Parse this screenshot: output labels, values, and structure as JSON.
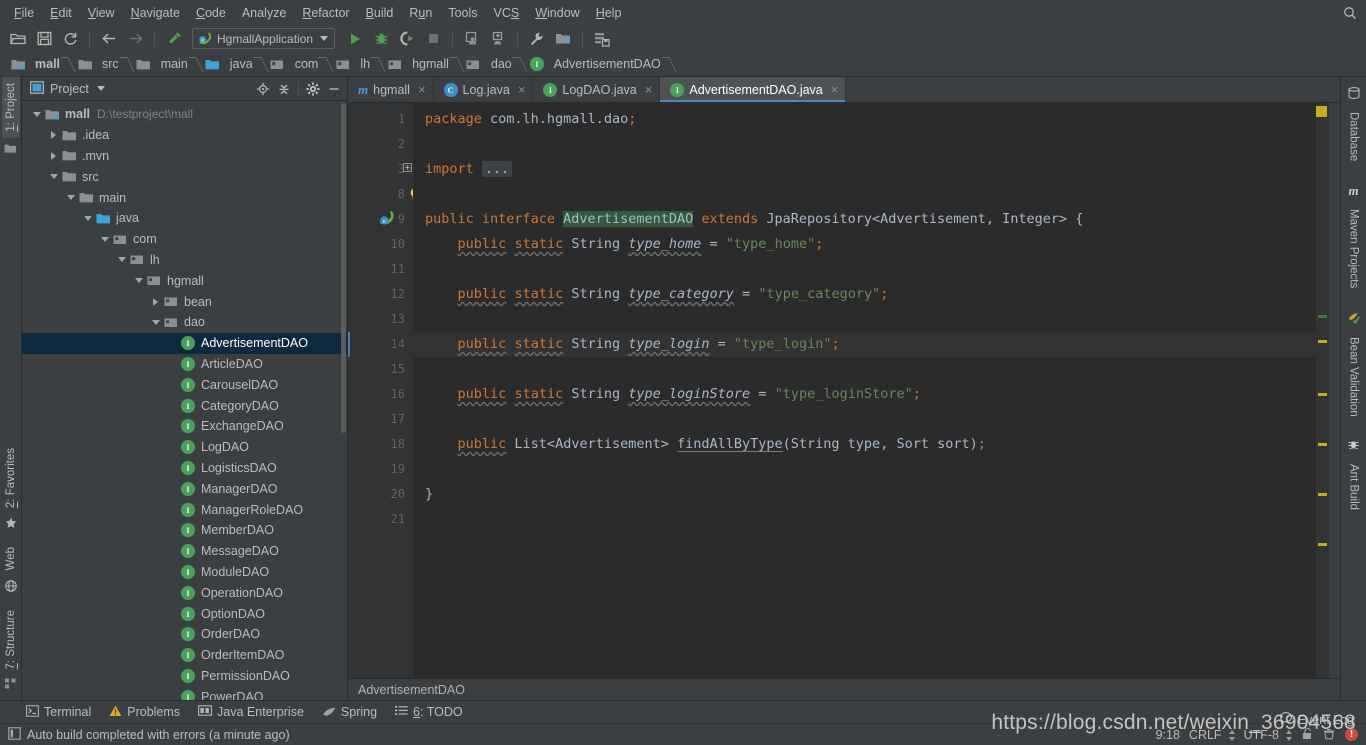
{
  "menubar": {
    "items": [
      "File",
      "Edit",
      "View",
      "Navigate",
      "Code",
      "Analyze",
      "Refactor",
      "Build",
      "Run",
      "Tools",
      "VCS",
      "Window",
      "Help"
    ],
    "search_icon": "search-icon"
  },
  "toolbar": {
    "icons": [
      "open-folder-icon",
      "save-icon",
      "sync-icon",
      "back-arrow-icon",
      "forward-arrow-icon",
      "build-hammer-icon"
    ],
    "run_config": "HgmallApplication",
    "run_icons": [
      "run-icon",
      "debug-icon",
      "run-coverage-icon",
      "stop-icon",
      "update-app-icon",
      "rerun-icon",
      "settings-wrench-icon",
      "project-structure-icon",
      "sdk-manager-icon"
    ]
  },
  "navbar": {
    "crumbs": [
      {
        "label": "mall",
        "icon": "module-icon",
        "bold": true
      },
      {
        "label": "src",
        "icon": "folder-icon",
        "bold": false
      },
      {
        "label": "main",
        "icon": "folder-icon",
        "bold": false
      },
      {
        "label": "java",
        "icon": "source-folder-icon",
        "bold": false
      },
      {
        "label": "com",
        "icon": "package-icon",
        "bold": false
      },
      {
        "label": "lh",
        "icon": "package-icon",
        "bold": false
      },
      {
        "label": "hgmall",
        "icon": "package-icon",
        "bold": false
      },
      {
        "label": "dao",
        "icon": "package-icon",
        "bold": false
      },
      {
        "label": "AdvertisementDAO",
        "icon": "interface-icon",
        "bold": false
      }
    ]
  },
  "left_strip": {
    "top_tabs": [
      {
        "label": "1: Project",
        "active": true,
        "icon": "project-icon"
      }
    ],
    "bottom_tabs": [
      {
        "label": "2: Favorites",
        "icon": "star-icon"
      },
      {
        "label": "Web",
        "icon": "globe-icon"
      },
      {
        "label": "7: Structure",
        "icon": "structure-icon"
      }
    ]
  },
  "right_strip": {
    "tabs": [
      {
        "label": "Database",
        "icon": "database-icon"
      },
      {
        "label": "Maven Projects",
        "icon": "maven-icon"
      },
      {
        "label": "Bean Validation",
        "icon": "bean-validation-icon"
      },
      {
        "label": "Ant Build",
        "icon": "ant-icon"
      }
    ]
  },
  "project_panel": {
    "title": "Project",
    "actions": [
      "locate-icon",
      "collapse-all-icon",
      "settings-gear-icon",
      "hide-icon"
    ],
    "tree": [
      {
        "label": "mall",
        "path": "D:\\testproject\\mall",
        "depth": 0,
        "arrow": "down",
        "icon": "module-icon",
        "bold": true
      },
      {
        "label": ".idea",
        "depth": 1,
        "arrow": "right",
        "icon": "folder-icon"
      },
      {
        "label": ".mvn",
        "depth": 1,
        "arrow": "right",
        "icon": "folder-icon"
      },
      {
        "label": "src",
        "depth": 1,
        "arrow": "down",
        "icon": "folder-icon"
      },
      {
        "label": "main",
        "depth": 2,
        "arrow": "down",
        "icon": "folder-icon"
      },
      {
        "label": "java",
        "depth": 3,
        "arrow": "down",
        "icon": "source-folder-icon"
      },
      {
        "label": "com",
        "depth": 4,
        "arrow": "down",
        "icon": "package-icon"
      },
      {
        "label": "lh",
        "depth": 5,
        "arrow": "down",
        "icon": "package-icon"
      },
      {
        "label": "hgmall",
        "depth": 6,
        "arrow": "down",
        "icon": "package-icon"
      },
      {
        "label": "bean",
        "depth": 7,
        "arrow": "right",
        "icon": "package-icon"
      },
      {
        "label": "dao",
        "depth": 7,
        "arrow": "down",
        "icon": "package-icon"
      },
      {
        "label": "AdvertisementDAO",
        "depth": 8,
        "arrow": "none",
        "icon": "interface-icon",
        "selected": true
      },
      {
        "label": "ArticleDAO",
        "depth": 8,
        "arrow": "none",
        "icon": "interface-icon"
      },
      {
        "label": "CarouselDAO",
        "depth": 8,
        "arrow": "none",
        "icon": "interface-icon"
      },
      {
        "label": "CategoryDAO",
        "depth": 8,
        "arrow": "none",
        "icon": "interface-icon"
      },
      {
        "label": "ExchangeDAO",
        "depth": 8,
        "arrow": "none",
        "icon": "interface-icon"
      },
      {
        "label": "LogDAO",
        "depth": 8,
        "arrow": "none",
        "icon": "interface-icon"
      },
      {
        "label": "LogisticsDAO",
        "depth": 8,
        "arrow": "none",
        "icon": "interface-icon"
      },
      {
        "label": "ManagerDAO",
        "depth": 8,
        "arrow": "none",
        "icon": "interface-icon"
      },
      {
        "label": "ManagerRoleDAO",
        "depth": 8,
        "arrow": "none",
        "icon": "interface-icon"
      },
      {
        "label": "MemberDAO",
        "depth": 8,
        "arrow": "none",
        "icon": "interface-icon"
      },
      {
        "label": "MessageDAO",
        "depth": 8,
        "arrow": "none",
        "icon": "interface-icon"
      },
      {
        "label": "ModuleDAO",
        "depth": 8,
        "arrow": "none",
        "icon": "interface-icon"
      },
      {
        "label": "OperationDAO",
        "depth": 8,
        "arrow": "none",
        "icon": "interface-icon"
      },
      {
        "label": "OptionDAO",
        "depth": 8,
        "arrow": "none",
        "icon": "interface-icon"
      },
      {
        "label": "OrderDAO",
        "depth": 8,
        "arrow": "none",
        "icon": "interface-icon"
      },
      {
        "label": "OrderItemDAO",
        "depth": 8,
        "arrow": "none",
        "icon": "interface-icon"
      },
      {
        "label": "PermissionDAO",
        "depth": 8,
        "arrow": "none",
        "icon": "interface-icon"
      },
      {
        "label": "PowerDAO",
        "depth": 8,
        "arrow": "none",
        "icon": "interface-icon"
      }
    ]
  },
  "editor": {
    "tabs": [
      {
        "label": "hgmall",
        "icon": "maven-module-icon",
        "active": false
      },
      {
        "label": "Log.java",
        "icon": "class-icon",
        "active": false
      },
      {
        "label": "LogDAO.java",
        "icon": "interface-icon",
        "active": false
      },
      {
        "label": "AdvertisementDAO.java",
        "icon": "interface-icon",
        "active": true
      }
    ],
    "close_label": "×",
    "line_numbers": [
      "1",
      "2",
      "3",
      "8",
      "9",
      "10",
      "11",
      "12",
      "13",
      "14",
      "15",
      "16",
      "17",
      "18",
      "19",
      "20",
      "21"
    ],
    "code_lines": [
      "package com.lh.hgmall.dao;",
      "",
      "import ...",
      "",
      "public interface AdvertisementDAO extends JpaRepository<Advertisement, Integer> {",
      "    public static String type_home = \"type_home\";",
      "",
      "    public static String type_category = \"type_category\";",
      "",
      "    public static String type_login = \"type_login\";",
      "",
      "    public static String type_loginStore = \"type_loginStore\";",
      "",
      "    public List<Advertisement> findAllByType(String type, Sort sort);",
      "",
      "}",
      ""
    ],
    "footer_breadcrumb": "AdvertisementDAO",
    "gutter_icons": [
      "lightbulb-icon",
      "spring-bean-icon"
    ]
  },
  "bottombar": {
    "items": [
      {
        "label": "Terminal",
        "icon": "terminal-icon"
      },
      {
        "label": "Problems",
        "icon": "warning-icon"
      },
      {
        "label": "Java Enterprise",
        "icon": "java-ee-icon"
      },
      {
        "label": "Spring",
        "icon": "spring-leaf-icon"
      },
      {
        "label": "6: TODO",
        "icon": "todo-list-icon"
      }
    ]
  },
  "statusbar": {
    "message": "Auto build completed with errors (a minute ago)",
    "message_icon": "build-status-icon",
    "caret_position": "9:18",
    "line_separator": "CRLF",
    "encoding": "UTF-8",
    "lock_icon": "unlocked-icon",
    "inspection_icon": "inspection-trash-icon",
    "error_badge": "!",
    "event_log": "Event Log",
    "event_log_icon": "event-log-icon"
  },
  "watermark": "https://blog.csdn.net/weixin_36904568",
  "colors": {
    "bg_panel": "#3c3f41",
    "bg_editor": "#2b2b2b",
    "bg_gutter": "#313335",
    "selection": "#0d293e",
    "tab_active": "#4e5254",
    "tab_underline": "#4a88c7",
    "keyword": "#cc7832",
    "string": "#6a8759",
    "text": "#a9b7c6",
    "field": "#9876aa",
    "class_highlight": "#32593d",
    "marker_warning": "#c9ad1e",
    "marker_ok": "#3a7d3a",
    "error_red": "#d1483f"
  }
}
